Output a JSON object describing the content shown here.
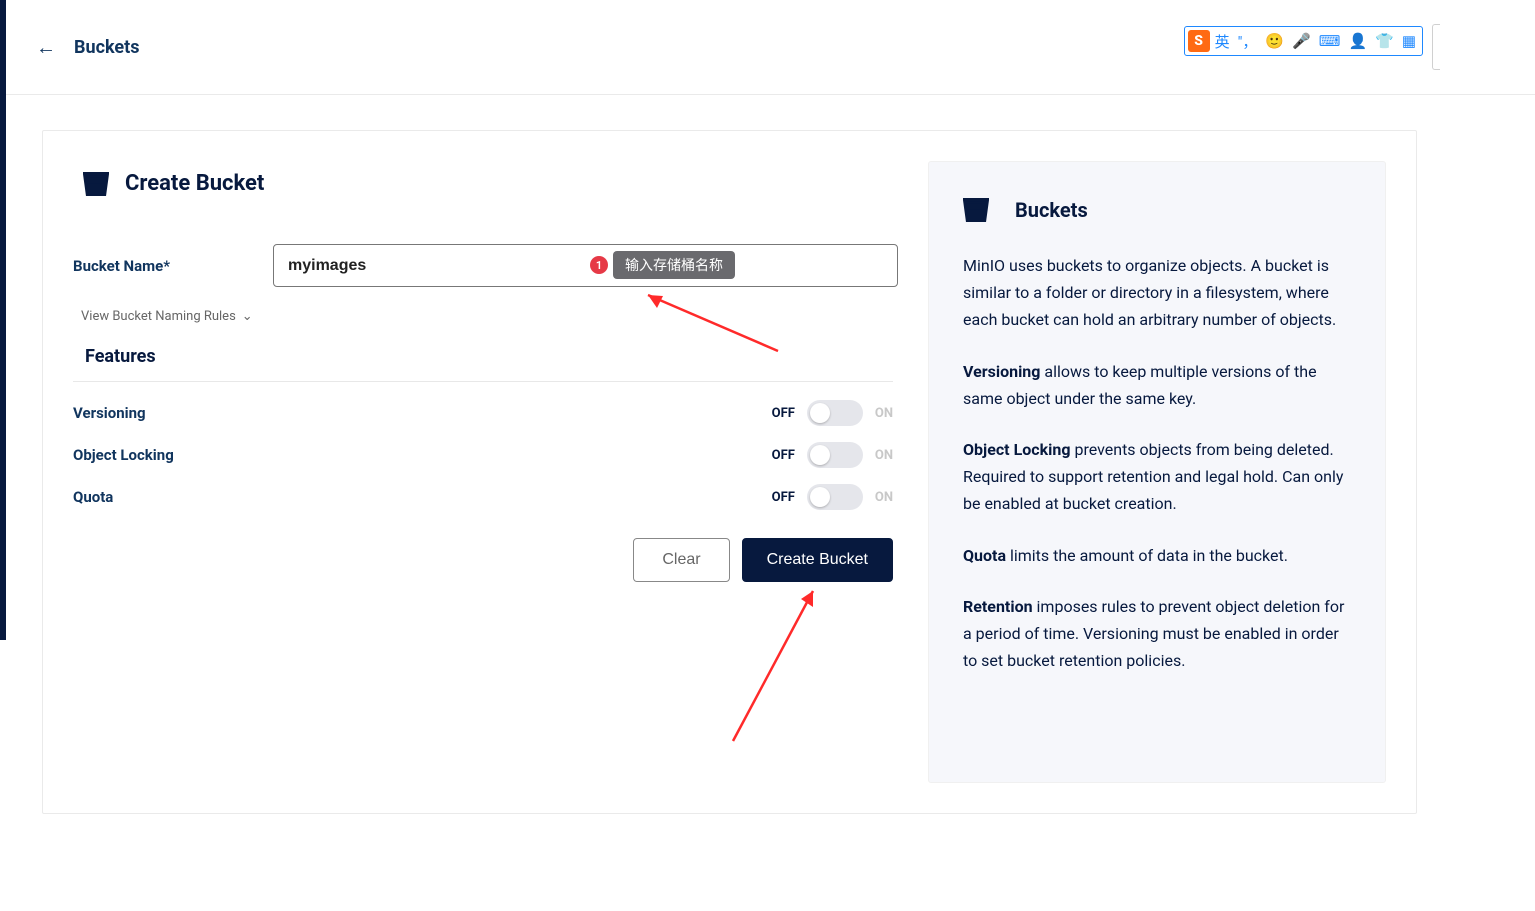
{
  "header": {
    "back_label": "Buckets"
  },
  "ime": {
    "mode": "英",
    "punct": "\"，",
    "emoji": "☻",
    "mic": "🎤",
    "kbd": "⌨",
    "user": "👤",
    "skin": "👕",
    "apps": "▦"
  },
  "form": {
    "title": "Create Bucket",
    "bucket_name_label": "Bucket Name*",
    "bucket_name_value": "myimages",
    "naming_rules": "View Bucket Naming Rules",
    "features_title": "Features",
    "features": {
      "versioning": "Versioning",
      "object_locking": "Object Locking",
      "quota": "Quota"
    },
    "off": "OFF",
    "on": "ON",
    "clear": "Clear",
    "create": "Create Bucket"
  },
  "annotations": {
    "badge1": "1",
    "hint1": "输入存储桶名称"
  },
  "help": {
    "title": "Buckets",
    "p1": "MinIO uses buckets to organize objects. A bucket is similar to a folder or directory in a filesystem, where each bucket can hold an arbitrary number of objects.",
    "p2_strong": "Versioning",
    "p2_rest": " allows to keep multiple versions of the same object under the same key.",
    "p3_strong": "Object Locking",
    "p3_rest": " prevents objects from being deleted. Required to support retention and legal hold. Can only be enabled at bucket creation.",
    "p4_strong": "Quota",
    "p4_rest": " limits the amount of data in the bucket.",
    "p5_strong": "Retention",
    "p5_rest": " imposes rules to prevent object deletion for a period of time. Versioning must be enabled in order to set bucket retention policies."
  }
}
